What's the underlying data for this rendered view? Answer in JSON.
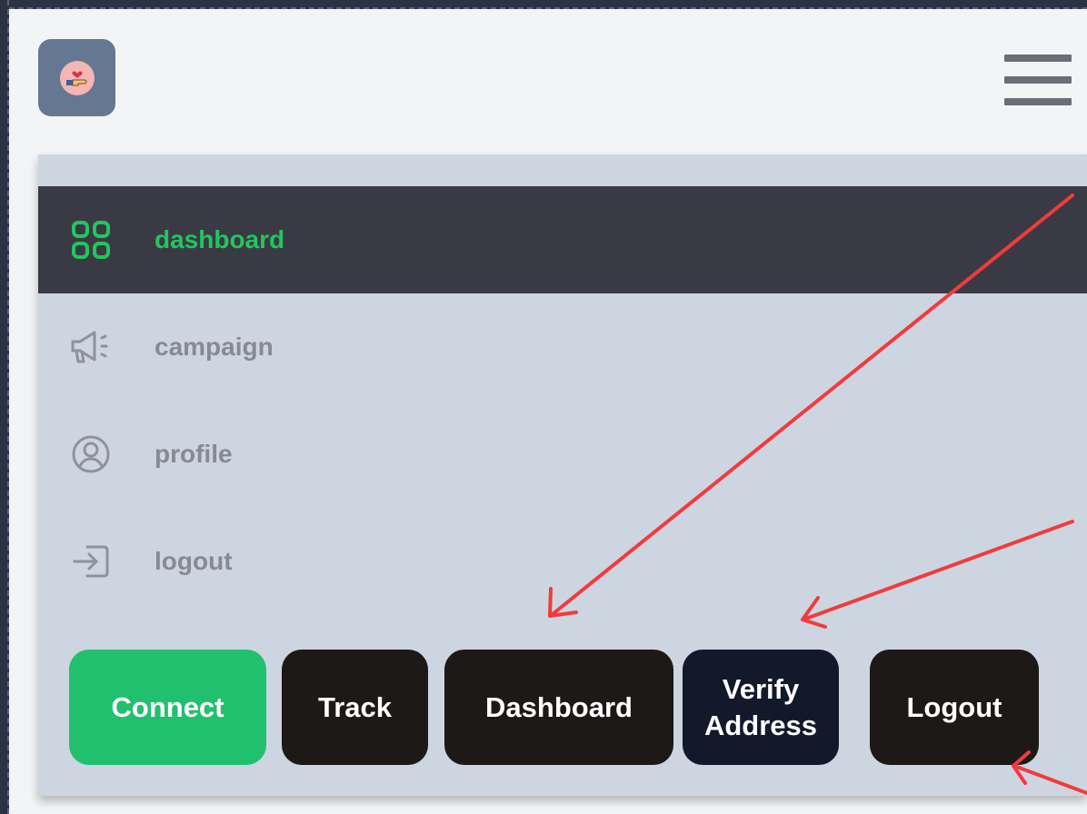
{
  "colors": {
    "accent_green": "#22c55e",
    "panel_bg": "#cdd5e1",
    "active_bg": "#3a3a44",
    "annotation_arrow": "#f23b3b"
  },
  "header": {
    "logo_icon": "hand-heart-icon",
    "menu_icon": "hamburger-menu-icon"
  },
  "sidebar": {
    "items": [
      {
        "label": "dashboard",
        "icon": "dashboard-grid-icon",
        "active": true
      },
      {
        "label": "campaign",
        "icon": "megaphone-icon",
        "active": false
      },
      {
        "label": "profile",
        "icon": "user-circle-icon",
        "active": false
      },
      {
        "label": "logout",
        "icon": "logout-icon",
        "active": false
      }
    ]
  },
  "buttons": {
    "connect": "Connect",
    "track": "Track",
    "dashboard": "Dashboard",
    "verify_line1": "Verify",
    "verify_line2": "Address",
    "logout": "Logout"
  }
}
